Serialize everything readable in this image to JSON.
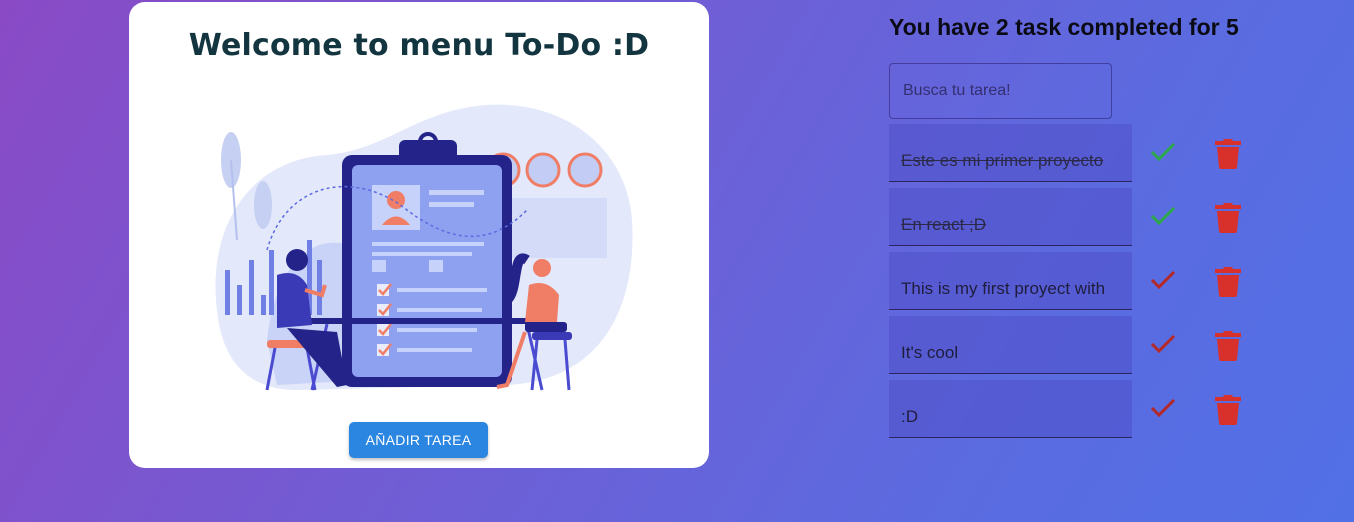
{
  "card": {
    "title": "Welcome to menu To-Do :D",
    "add_button_label": "AÑADIR TAREA"
  },
  "counter_text": "You have 2 task completed for 5",
  "search": {
    "placeholder": "Busca tu tarea!",
    "value": ""
  },
  "tasks": [
    {
      "text": "Este es mi primer proyecto",
      "completed": true
    },
    {
      "text": "En react ;D",
      "completed": true
    },
    {
      "text": "This is my first proyect with",
      "completed": false
    },
    {
      "text": "It's cool",
      "completed": false
    },
    {
      "text": ":D",
      "completed": false
    }
  ],
  "colors": {
    "check_done": "#2ea84a",
    "check_pending": "#b52828",
    "trash": "#d8312c",
    "button": "#2a86e0"
  },
  "icons": {
    "check": "check-icon",
    "delete": "trash-icon"
  }
}
